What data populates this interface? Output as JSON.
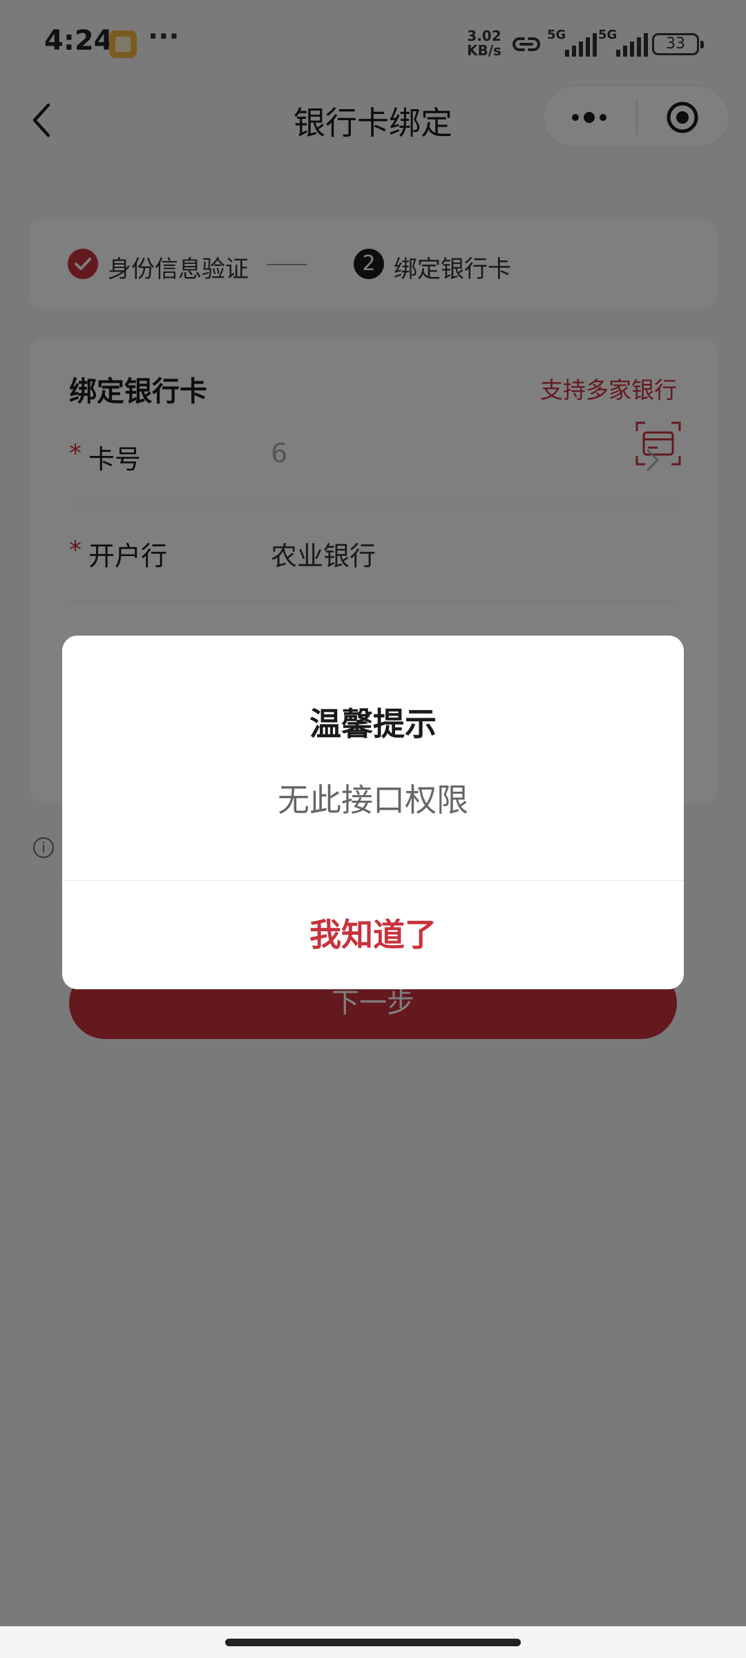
{
  "status_bar": {
    "time": "4:24",
    "more_dots": "···",
    "net_speed_value": "3.02",
    "net_speed_unit": "KB/s",
    "sim1_label": "5G",
    "sim2_label": "5G",
    "battery": "33"
  },
  "nav": {
    "title": "银行卡绑定"
  },
  "steps": {
    "step1_label": "身份信息验证",
    "step2_number": "2",
    "step2_label": "绑定银行卡"
  },
  "form": {
    "title": "绑定银行卡",
    "supported_banks_link": "支持多家银行",
    "required_mark": "*",
    "card_number_label": "卡号",
    "card_number_value": "6",
    "bank_label": "开户行",
    "bank_value": "农业银行"
  },
  "hint_icon_glyph": "i",
  "next_button_label": "下一步",
  "dialog": {
    "title": "温馨提示",
    "message": "无此接口权限",
    "confirm_label": "我知道了"
  },
  "colors": {
    "accent": "#c8323c",
    "overlay": "rgba(0,0,0,0.5)"
  }
}
